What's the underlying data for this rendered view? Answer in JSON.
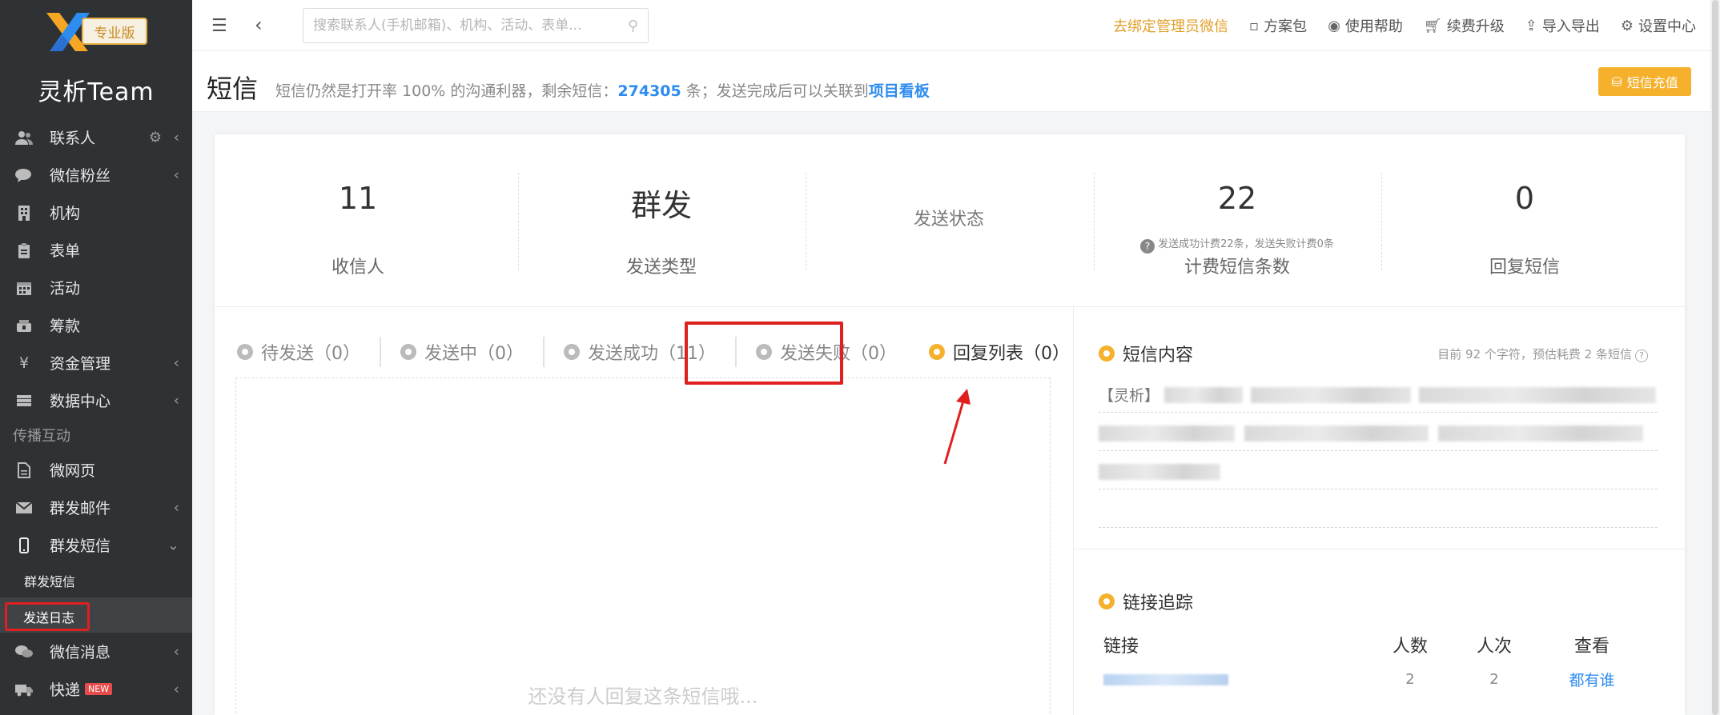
{
  "app": {
    "edition_badge": "专业版",
    "brand": "灵析Team"
  },
  "sidebar": {
    "items": [
      {
        "label": "联系人",
        "icon": "contacts-icon",
        "arrow": "‹",
        "gear": true
      },
      {
        "label": "微信粉丝",
        "icon": "wechat-icon",
        "arrow": "‹"
      },
      {
        "label": "机构",
        "icon": "building-icon",
        "arrow": ""
      },
      {
        "label": "表单",
        "icon": "clipboard-icon",
        "arrow": ""
      },
      {
        "label": "活动",
        "icon": "calendar-icon",
        "arrow": ""
      },
      {
        "label": "筹款",
        "icon": "donation-icon",
        "arrow": ""
      },
      {
        "label": "资金管理",
        "icon": "yen-icon",
        "arrow": "‹"
      },
      {
        "label": "数据中心",
        "icon": "database-icon",
        "arrow": "‹"
      }
    ],
    "section": "传播互动",
    "items2": [
      {
        "label": "微网页",
        "icon": "page-icon",
        "arrow": ""
      },
      {
        "label": "群发邮件",
        "icon": "mail-icon",
        "arrow": "‹"
      },
      {
        "label": "群发短信",
        "icon": "phone-icon",
        "arrow": "⌄"
      }
    ],
    "sub_items": [
      "群发短信",
      "发送日志"
    ],
    "items3": [
      {
        "label": "微信消息",
        "icon": "wechat-msg-icon",
        "arrow": "‹"
      },
      {
        "label": "快递",
        "icon": "truck-icon",
        "arrow": "‹",
        "badge": "NEW"
      }
    ]
  },
  "topbar": {
    "search_placeholder": "搜索联系人(手机邮箱)、机构、活动、表单...",
    "bind_wechat": "去绑定管理员微信",
    "links": [
      "方案包",
      "使用帮助",
      "续费升级",
      "导入导出",
      "设置中心"
    ]
  },
  "page": {
    "title": "短信",
    "desc_prefix": "短信仍然是打开率 100% 的沟通利器，剩余短信：",
    "remaining": "274305",
    "desc_mid": " 条；发送完成后可以关联到",
    "desc_link": "项目看板",
    "recharge_button": "短信充值"
  },
  "stats": [
    {
      "value": "11",
      "label": "收信人"
    },
    {
      "value": "群发",
      "label": "发送类型"
    },
    {
      "value": "",
      "mid": "发送状态",
      "label": ""
    },
    {
      "value": "22",
      "note": "发送成功计费22条，发送失败计费0条",
      "label": "计费短信条数"
    },
    {
      "value": "0",
      "label": "回复短信"
    }
  ],
  "tabs": [
    {
      "label": "待发送（0）",
      "selected": false
    },
    {
      "label": "发送中（0）",
      "selected": false
    },
    {
      "label": "发送成功（11）",
      "selected": false
    },
    {
      "label": "发送失败（0）",
      "selected": false
    },
    {
      "label": "回复列表（0）",
      "selected": true
    }
  ],
  "reply_empty": "还没有人回复这条短信哦...",
  "sms_content": {
    "title": "短信内容",
    "meta": "目前 92 个字符，预估耗费 2 条短信",
    "prefix": "【灵析】"
  },
  "link_tracking": {
    "title": "链接追踪",
    "columns": [
      "链接",
      "人数",
      "人次",
      "查看"
    ],
    "rows": [
      {
        "count": "2",
        "times": "2",
        "view": "都有谁"
      }
    ]
  },
  "colors": {
    "accent": "#f5b12c",
    "link": "#2d8cf0",
    "highlight": "#e02020",
    "sidebar_bg": "#2f3235"
  }
}
